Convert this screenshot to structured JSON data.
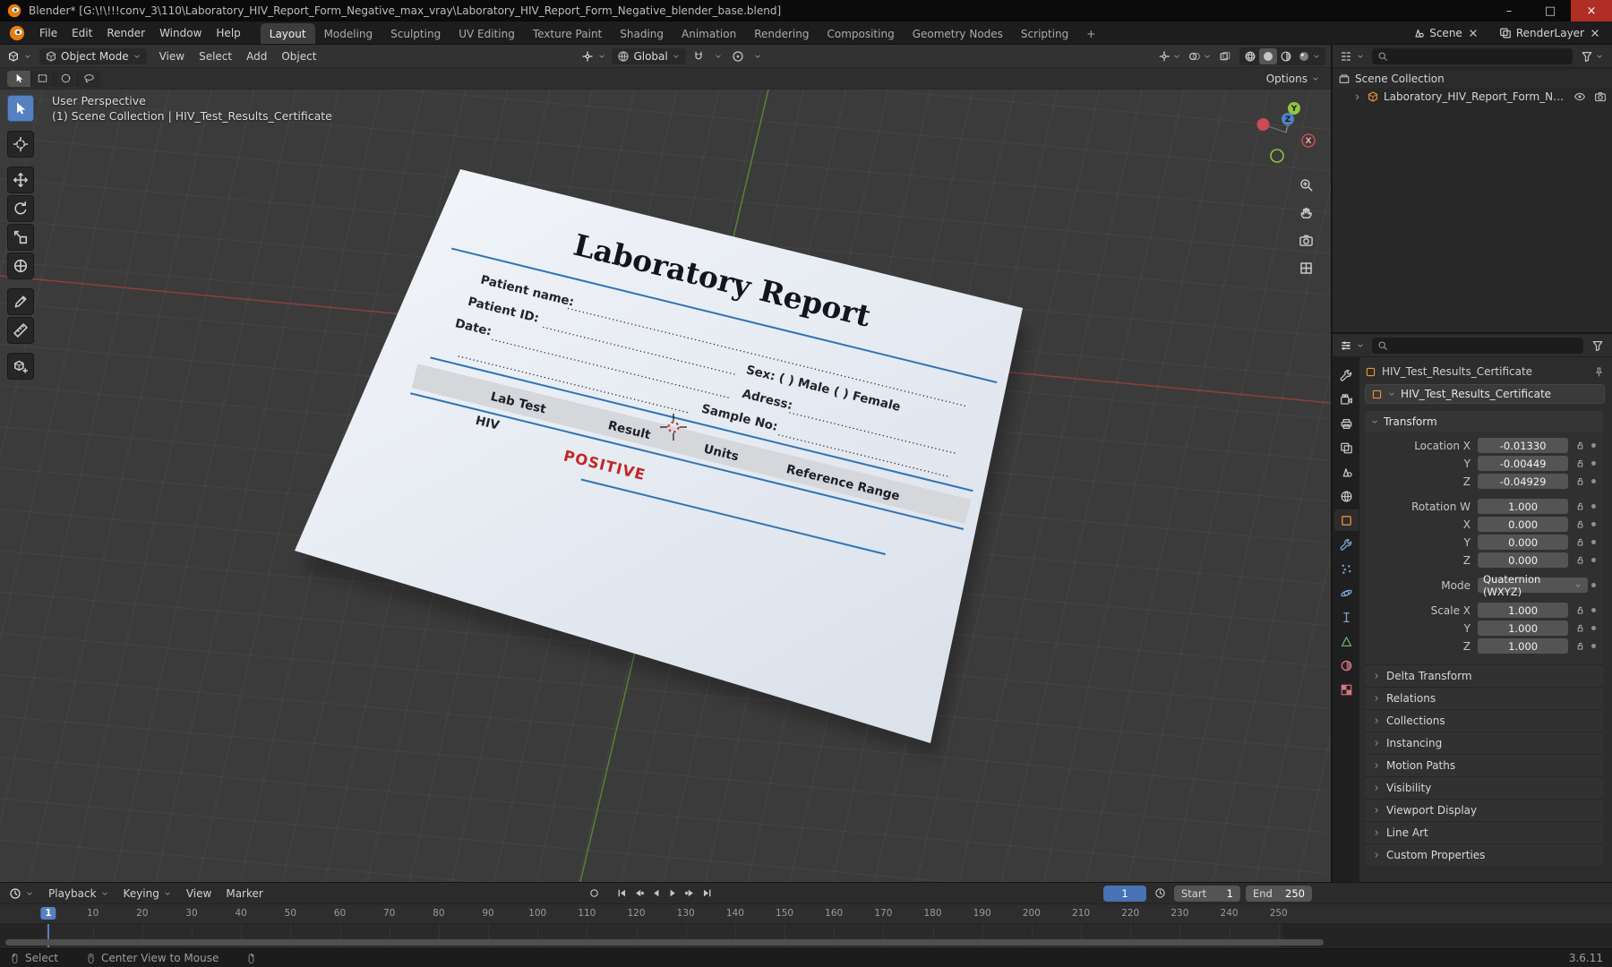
{
  "titlebar": {
    "title": "Blender* [G:\\!\\!!!conv_3\\110\\Laboratory_HIV_Report_Form_Negative_max_vray\\Laboratory_HIV_Report_Form_Negative_blender_base.blend]"
  },
  "topbar": {
    "menus": [
      "File",
      "Edit",
      "Render",
      "Window",
      "Help"
    ],
    "workspaces": [
      {
        "label": "Layout",
        "active": true
      },
      {
        "label": "Modeling"
      },
      {
        "label": "Sculpting"
      },
      {
        "label": "UV Editing"
      },
      {
        "label": "Texture Paint"
      },
      {
        "label": "Shading"
      },
      {
        "label": "Animation"
      },
      {
        "label": "Rendering"
      },
      {
        "label": "Compositing"
      },
      {
        "label": "Geometry Nodes"
      },
      {
        "label": "Scripting"
      },
      {
        "label": "+"
      }
    ],
    "scene_label": "Scene",
    "view_layer_label": "RenderLayer"
  },
  "viewport": {
    "mode": "Object Mode",
    "menus": [
      "View",
      "Select",
      "Add",
      "Object"
    ],
    "orientation": "Global",
    "options_label": "Options",
    "overlay_line1": "User Perspective",
    "overlay_line2": "(1) Scene Collection | HIV_Test_Results_Certificate",
    "tools": [
      "tweak-select",
      "cursor",
      "move",
      "rotate",
      "scale",
      "transform",
      "annotate",
      "measure",
      "add-cube"
    ],
    "gizmo": {
      "x": "X",
      "y": "Y",
      "z": "Z"
    }
  },
  "certificate": {
    "title": "Laboratory Report",
    "patient_name": "Patient name:",
    "patient_id": "Patient ID:",
    "date": "Date:",
    "sex": "Sex: ( ) Male ( ) Female",
    "address": "Adress:",
    "sample_no": "Sample No:",
    "col_test": "Lab Test",
    "col_result": "Result",
    "col_units": "Units",
    "col_range": "Reference Range",
    "row_test": "HIV",
    "row_result": "POSITIVE",
    "positive_color": "#c32727",
    "line_color": "#2e74b5"
  },
  "outliner": {
    "scene_collection": "Scene Collection",
    "object_name": "Laboratory_HIV_Report_Form_Negative"
  },
  "properties": {
    "breadcrumb": "HIV_Test_Results_Certificate",
    "id_name": "HIV_Test_Results_Certificate",
    "transform_title": "Transform",
    "rows": [
      {
        "label": "Location X",
        "value": "-0.01330"
      },
      {
        "label": "Y",
        "value": "-0.00449"
      },
      {
        "label": "Z",
        "value": "-0.04929"
      },
      {
        "label": "Rotation W",
        "value": "1.000",
        "gap": true
      },
      {
        "label": "X",
        "value": "0.000"
      },
      {
        "label": "Y",
        "value": "0.000"
      },
      {
        "label": "Z",
        "value": "0.000"
      },
      {
        "label": "Mode",
        "value": "Quaternion (WXYZ)",
        "dropdown": true,
        "gap": true
      },
      {
        "label": "Scale X",
        "value": "1.000",
        "gap": true
      },
      {
        "label": "Y",
        "value": "1.000"
      },
      {
        "label": "Z",
        "value": "1.000"
      }
    ],
    "panels": [
      "Delta Transform",
      "Relations",
      "Collections",
      "Instancing",
      "Motion Paths",
      "Visibility",
      "Viewport Display",
      "Line Art",
      "Custom Properties"
    ],
    "tabs": [
      {
        "name": "tool"
      },
      {
        "name": "render"
      },
      {
        "name": "output"
      },
      {
        "name": "view-layer"
      },
      {
        "name": "scene"
      },
      {
        "name": "world"
      },
      {
        "name": "object",
        "active": true
      },
      {
        "name": "modifiers"
      },
      {
        "name": "particles"
      },
      {
        "name": "physics"
      },
      {
        "name": "constraints"
      },
      {
        "name": "data"
      },
      {
        "name": "material"
      },
      {
        "name": "texture"
      }
    ]
  },
  "timeline": {
    "menus": [
      "Playback",
      "Keying",
      "View",
      "Marker"
    ],
    "current_frame": "1",
    "start_label": "Start",
    "start_value": "1",
    "end_label": "End",
    "end_value": "250",
    "ticks": [
      10,
      20,
      30,
      40,
      50,
      60,
      70,
      80,
      90,
      100,
      110,
      120,
      130,
      140,
      150,
      160,
      170,
      180,
      190,
      200,
      210,
      220,
      230,
      240,
      250
    ],
    "playhead": "1"
  },
  "statusbar": {
    "items": [
      {
        "icon": "mouse-l",
        "label": "Select"
      },
      {
        "icon": "mouse-m",
        "label": "Center View to Mouse"
      },
      {
        "icon": "mouse-r",
        "label": ""
      }
    ],
    "version": "3.6.11"
  },
  "colors": {
    "accent": "#4772b3",
    "axis_x": "#a04040",
    "axis_y": "#5f8f33",
    "object_icon": "#e8913a"
  }
}
